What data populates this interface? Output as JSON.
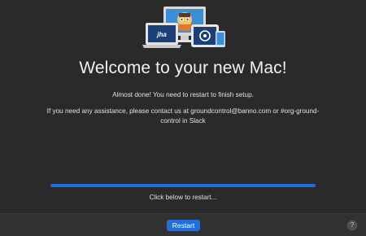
{
  "welcome": {
    "title": "Welcome to your new Mac!",
    "message": "Almost done! You need to restart to finish setup.",
    "assistance": "If you need any assistance, please contact us at groundcontrol@banno.com or #org-ground-control in Slack",
    "progress": 1.0,
    "hint": "Click below to restart..."
  },
  "hero": {
    "laptop_logo_text": "jha",
    "icons": [
      "monitor-icon",
      "laptop-icon",
      "tablet-icon",
      "robot-mascot-icon"
    ]
  },
  "footer": {
    "restart_label": "Restart",
    "help_label": "?"
  },
  "colors": {
    "accent": "#1f6fe3",
    "background": "#2a2a2a",
    "footer": "#323232"
  }
}
